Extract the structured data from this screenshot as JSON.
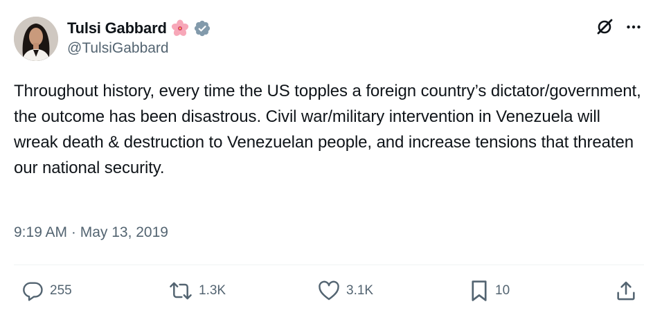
{
  "author": {
    "display_name": "Tulsi Gabbard",
    "handle": "@TulsiGabbard",
    "emoji_icon": "hibiscus-flower-icon",
    "verified_icon": "verified-badge-icon",
    "verified_color": "#829aab"
  },
  "header_icons": {
    "grok": "grok-icon",
    "more": "more-icon"
  },
  "post": {
    "text": "Throughout history, every time the US topples a foreign country’s dictator/government, the outcome has been disastrous. Civil war/military intervention in Venezuela will wreak death & destruction to Venezuelan people, and increase tensions that threaten our national security.",
    "timestamp": "9:19 AM · May 13, 2019"
  },
  "actions": {
    "replies": {
      "icon": "reply-icon",
      "count": "255"
    },
    "reposts": {
      "icon": "repost-icon",
      "count": "1.3K"
    },
    "likes": {
      "icon": "heart-icon",
      "count": "3.1K"
    },
    "bookmarks": {
      "icon": "bookmark-icon",
      "count": "10"
    },
    "share": {
      "icon": "share-icon"
    }
  },
  "colors": {
    "text": "#0f1419",
    "secondary": "#536471",
    "divider": "#eff3f4"
  }
}
